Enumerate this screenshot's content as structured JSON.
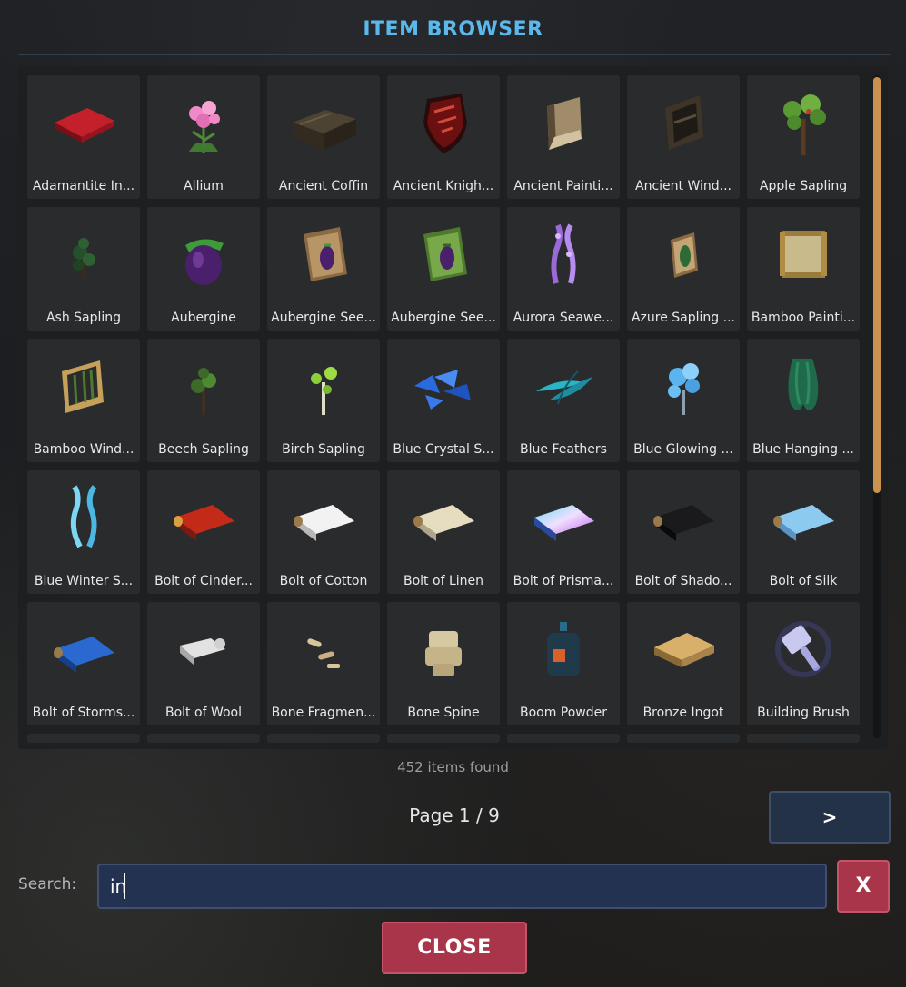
{
  "window": {
    "title": "ITEM BROWSER"
  },
  "items": [
    {
      "label": "Adamantite In...",
      "icon": "adamantite-ingot-icon"
    },
    {
      "label": "Allium",
      "icon": "allium-icon"
    },
    {
      "label": "Ancient Coffin",
      "icon": "ancient-coffin-icon"
    },
    {
      "label": "Ancient Knigh...",
      "icon": "ancient-knight-shield-icon"
    },
    {
      "label": "Ancient Painti...",
      "icon": "ancient-painting-icon"
    },
    {
      "label": "Ancient Wind...",
      "icon": "ancient-window-icon"
    },
    {
      "label": "Apple Sapling",
      "icon": "apple-sapling-icon"
    },
    {
      "label": "Ash Sapling",
      "icon": "ash-sapling-icon"
    },
    {
      "label": "Aubergine",
      "icon": "aubergine-icon"
    },
    {
      "label": "Aubergine See...",
      "icon": "aubergine-seeds-icon"
    },
    {
      "label": "Aubergine See...",
      "icon": "aubergine-seeds-green-icon"
    },
    {
      "label": "Aurora Seawe...",
      "icon": "aurora-seaweed-icon"
    },
    {
      "label": "Azure Sapling ...",
      "icon": "azure-sapling-seeds-icon"
    },
    {
      "label": "Bamboo Painti...",
      "icon": "bamboo-painting-icon"
    },
    {
      "label": "Bamboo Wind...",
      "icon": "bamboo-window-icon"
    },
    {
      "label": "Beech Sapling",
      "icon": "beech-sapling-icon"
    },
    {
      "label": "Birch Sapling",
      "icon": "birch-sapling-icon"
    },
    {
      "label": "Blue Crystal S...",
      "icon": "blue-crystal-shards-icon"
    },
    {
      "label": "Blue Feathers",
      "icon": "blue-feathers-icon"
    },
    {
      "label": "Blue Glowing ...",
      "icon": "blue-glowing-mushroom-icon"
    },
    {
      "label": "Blue Hanging ...",
      "icon": "blue-hanging-moss-icon"
    },
    {
      "label": "Blue Winter S...",
      "icon": "blue-winter-sprout-icon"
    },
    {
      "label": "Bolt of Cinder...",
      "icon": "bolt-of-cinder-icon"
    },
    {
      "label": "Bolt of Cotton",
      "icon": "bolt-of-cotton-icon"
    },
    {
      "label": "Bolt of Linen",
      "icon": "bolt-of-linen-icon"
    },
    {
      "label": "Bolt of Prisma...",
      "icon": "bolt-of-prismatic-icon"
    },
    {
      "label": "Bolt of Shado...",
      "icon": "bolt-of-shadow-icon"
    },
    {
      "label": "Bolt of Silk",
      "icon": "bolt-of-silk-icon"
    },
    {
      "label": "Bolt of Storms...",
      "icon": "bolt-of-storms-icon"
    },
    {
      "label": "Bolt of Wool",
      "icon": "bolt-of-wool-icon"
    },
    {
      "label": "Bone Fragmen...",
      "icon": "bone-fragments-icon"
    },
    {
      "label": "Bone Spine",
      "icon": "bone-spine-icon"
    },
    {
      "label": "Boom Powder",
      "icon": "boom-powder-icon"
    },
    {
      "label": "Bronze Ingot",
      "icon": "bronze-ingot-icon"
    },
    {
      "label": "Building Brush",
      "icon": "building-brush-icon"
    }
  ],
  "results": {
    "count_text": "452 items found"
  },
  "pagination": {
    "page_text": "Page 1 / 9",
    "next_label": ">"
  },
  "search": {
    "label": "Search:",
    "value": "in",
    "clear_label": "X"
  },
  "footer": {
    "close_label": "CLOSE"
  },
  "colors": {
    "title": "#5bb8ea",
    "panel": "#1e1f21",
    "tile": "#2a2b2d",
    "scroll_thumb": "#c9924f",
    "danger_button": "#a8354a",
    "next_button": "#243248",
    "search_field": "#243252"
  }
}
